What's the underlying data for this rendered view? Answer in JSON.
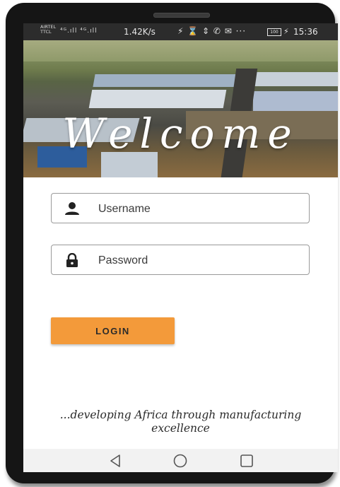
{
  "status_bar": {
    "carrier_top": "AIRTEL",
    "carrier_bottom": "TTCL",
    "signal": "⁴ᴳ.ıll ⁴ᴳ.ıll",
    "network_speed": "1.42K/s",
    "icons": "⚡ ⌛ ⇕ ✆ ✉ ···",
    "battery": "100",
    "time": "15:36"
  },
  "hero": {
    "welcome_text": "Welcome"
  },
  "form": {
    "username_placeholder": "Username",
    "password_placeholder": "Password",
    "login_label": "LOGIN"
  },
  "tagline": {
    "line1": "...developing Africa through manufacturing",
    "line2": "excellence"
  },
  "icons": {
    "user": "user-icon",
    "lock": "lock-icon",
    "back": "back-triangle-icon",
    "home": "home-circle-icon",
    "recents": "recents-square-icon"
  },
  "colors": {
    "accent": "#f39a3a",
    "frame": "#151515"
  }
}
